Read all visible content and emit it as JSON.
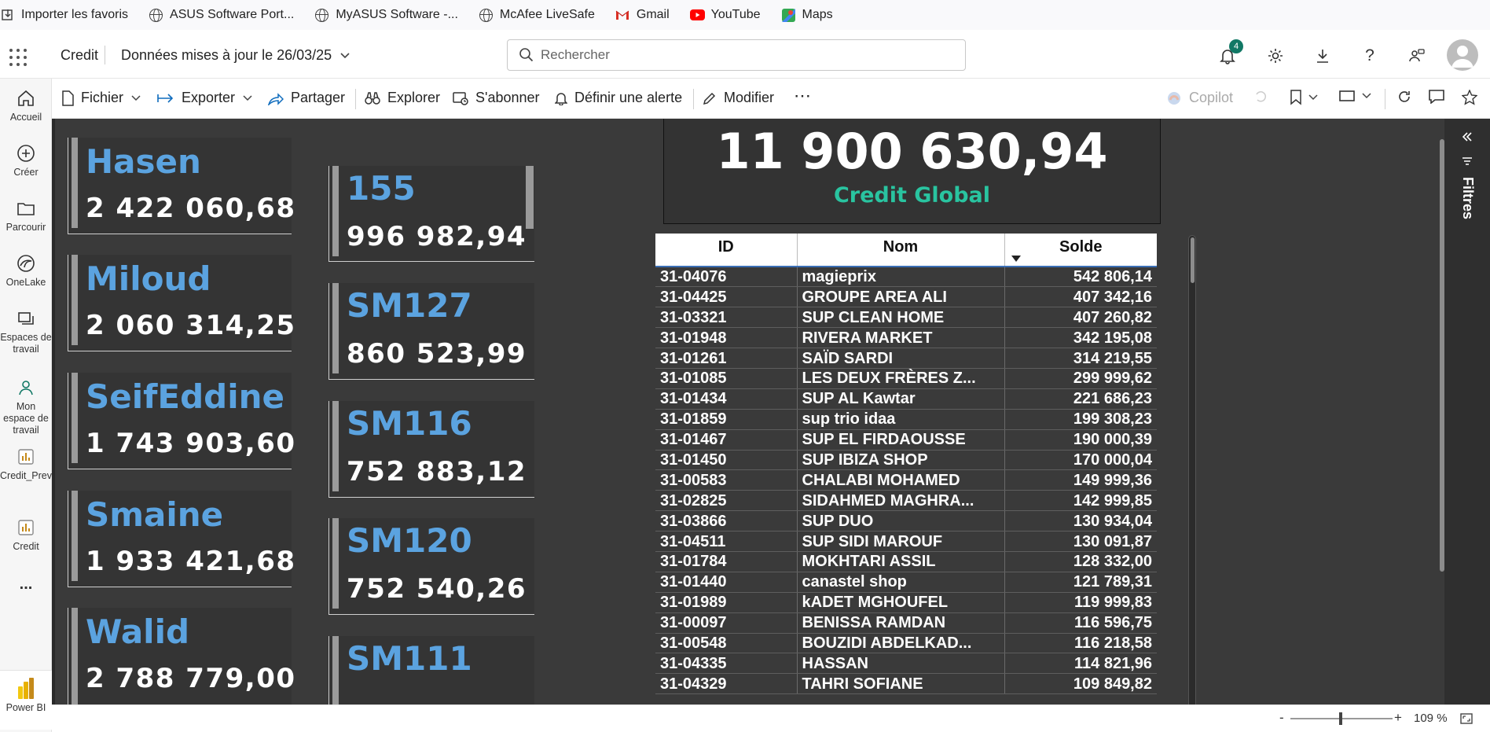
{
  "bookmarks": [
    {
      "label": "Importer les favoris",
      "icon": "import-icon"
    },
    {
      "label": "ASUS Software Port...",
      "icon": "globe-icon"
    },
    {
      "label": "MyASUS Software -...",
      "icon": "globe-icon"
    },
    {
      "label": "McAfee LiveSafe",
      "icon": "globe-icon"
    },
    {
      "label": "Gmail",
      "icon": "gmail-icon"
    },
    {
      "label": "YouTube",
      "icon": "youtube-icon"
    },
    {
      "label": "Maps",
      "icon": "maps-icon"
    }
  ],
  "header": {
    "report_name": "Credit",
    "updated": "Données mises à jour le 26/03/25",
    "search_placeholder": "Rechercher",
    "notification_count": "4"
  },
  "toolbar": {
    "file": "Fichier",
    "export": "Exporter",
    "share": "Partager",
    "explore": "Explorer",
    "subscribe": "S'abonner",
    "alert": "Définir une alerte",
    "edit": "Modifier",
    "more": "⋯",
    "copilot": "Copilot"
  },
  "rail": [
    {
      "label": "Accueil",
      "icon": "home-icon"
    },
    {
      "label": "Créer",
      "icon": "create-icon"
    },
    {
      "label": "Parcourir",
      "icon": "folder-icon"
    },
    {
      "label": "OneLake",
      "icon": "onelake-icon"
    },
    {
      "label": "Espaces de travail",
      "icon": "workspaces-icon"
    },
    {
      "label": "Mon espace de travail",
      "icon": "my-workspace-icon"
    },
    {
      "label": "Credit_Prevente",
      "icon": "report-icon"
    },
    {
      "label": "Credit",
      "icon": "report-icon"
    },
    {
      "label": "...",
      "icon": "more-icon"
    },
    {
      "label": "Power BI",
      "icon": "powerbi-icon"
    }
  ],
  "left_cards": [
    {
      "name": "Hasen",
      "value": "2 422 060,68"
    },
    {
      "name": "Miloud",
      "value": "2 060 314,25"
    },
    {
      "name": "SeifEddine",
      "value": "1 743 903,60"
    },
    {
      "name": "Smaine",
      "value": "1 933 421,68"
    },
    {
      "name": "Walid",
      "value": "2 788 779,00"
    }
  ],
  "mid_cards": [
    {
      "name": "155",
      "value": "996 982,94"
    },
    {
      "name": "SM127",
      "value": "860 523,99"
    },
    {
      "name": "SM116",
      "value": "752 883,12"
    },
    {
      "name": "SM120",
      "value": "752 540,26"
    },
    {
      "name": "SM111",
      "value": ""
    }
  ],
  "kpi": {
    "value": "11 900 630,94",
    "label": "Credit Global"
  },
  "table": {
    "columns": [
      "ID",
      "Nom",
      "Solde"
    ],
    "rows": [
      [
        "31-04076",
        "magieprix",
        "542 806,14"
      ],
      [
        "31-04425",
        "GROUPE AREA ALI",
        "407 342,16"
      ],
      [
        "31-03321",
        "SUP CLEAN HOME",
        "407 260,82"
      ],
      [
        "31-01948",
        "RIVERA MARKET",
        "342 195,08"
      ],
      [
        "31-01261",
        "SAÏD SARDI",
        "314 219,55"
      ],
      [
        "31-01085",
        "LES DEUX FRÈRES Z...",
        "299 999,62"
      ],
      [
        "31-01434",
        "SUP AL Kawtar",
        "221 686,23"
      ],
      [
        "31-01859",
        "sup trio idaa",
        "199 308,23"
      ],
      [
        "31-01467",
        "SUP EL FIRDAOUSSE",
        "190 000,39"
      ],
      [
        "31-01450",
        "SUP IBIZA SHOP",
        "170 000,04"
      ],
      [
        "31-00583",
        "CHALABI MOHAMED",
        "149 999,36"
      ],
      [
        "31-02825",
        "SIDAHMED MAGHRA...",
        "142 999,85"
      ],
      [
        "31-03866",
        "SUP DUO",
        "130 934,04"
      ],
      [
        "31-04511",
        "SUP SIDI MAROUF",
        "130 091,87"
      ],
      [
        "31-01784",
        "MOKHTARI ASSIL",
        "128 332,00"
      ],
      [
        "31-01440",
        "canastel shop",
        "121 789,31"
      ],
      [
        "31-01989",
        "kADET MGHOUFEL",
        "119 999,83"
      ],
      [
        "31-00097",
        "BENISSA RAMDAN",
        "116 596,75"
      ],
      [
        "31-00548",
        "BOUZIDI ABDELKAD...",
        "116 218,58"
      ],
      [
        "31-04335",
        "HASSAN",
        "114 821,96"
      ],
      [
        "31-04329",
        "TAHRI SOFIANE",
        "109 849,82"
      ]
    ]
  },
  "filters_label": "Filtres",
  "status": {
    "zoom": "109 %",
    "minus": "-",
    "plus": "+"
  },
  "colors": {
    "accent": "#5ba3e0",
    "kpi_label": "#29c4a0",
    "canvas": "#3a3a3a"
  }
}
